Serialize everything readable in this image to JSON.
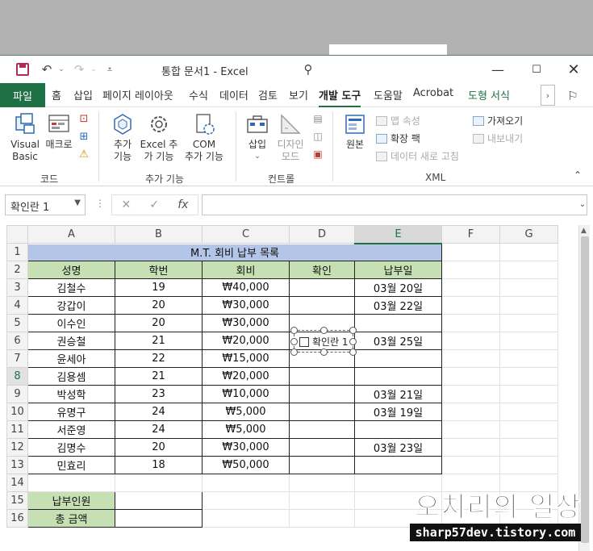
{
  "titlebar": {
    "doc_title": "통합 문서1  -  Excel",
    "undo_icon": "undo-icon",
    "redo_icon": "redo-icon",
    "search_icon": "search-icon"
  },
  "tabs": [
    "파일",
    "홈",
    "삽입",
    "페이지 레이아웃",
    "수식",
    "데이터",
    "검토",
    "보기",
    "개발 도구",
    "도움말",
    "Acrobat",
    "도형 서식"
  ],
  "active_tab": "개발 도구",
  "ribbon": {
    "code": {
      "label": "코드",
      "visual_basic": "Visual\nBasic",
      "macro": "매크로"
    },
    "addins": {
      "label": "추가 기능",
      "addin": "추가\n기능",
      "excel_addin": "Excel 추\n가 기능",
      "com_addin": "COM\n추가 기능"
    },
    "controls": {
      "label": "컨트롤",
      "insert": "삽입",
      "design_mode": "디자인\n모드"
    },
    "xml": {
      "label": "XML",
      "source": "원본",
      "map_props": "맵 속성",
      "expansion_pack": "확장 팩",
      "refresh_data": "데이터 새로 고침",
      "import": "가져오기",
      "export": "내보내기"
    }
  },
  "formula_bar": {
    "name_box": "확인란 1",
    "fx": "fx"
  },
  "sheet": {
    "columns": [
      "A",
      "B",
      "C",
      "D",
      "E",
      "F",
      "G"
    ],
    "selected_column": "E",
    "selected_row": "8",
    "title": "M.T. 회비 납부 목록",
    "headers": [
      "성명",
      "학번",
      "회비",
      "확인",
      "납부일"
    ],
    "rows": [
      {
        "n": "3",
        "name": "김철수",
        "id": "19",
        "fee": "₩40,000",
        "date": "03월 20일"
      },
      {
        "n": "4",
        "name": "강갑이",
        "id": "20",
        "fee": "₩30,000",
        "date": "03월 22일"
      },
      {
        "n": "5",
        "name": "이수인",
        "id": "20",
        "fee": "₩30,000",
        "date": ""
      },
      {
        "n": "6",
        "name": "권승철",
        "id": "21",
        "fee": "₩20,000",
        "date": "03월 25일"
      },
      {
        "n": "7",
        "name": "윤세아",
        "id": "22",
        "fee": "₩15,000",
        "date": ""
      },
      {
        "n": "8",
        "name": "김용셈",
        "id": "21",
        "fee": "₩20,000",
        "date": ""
      },
      {
        "n": "9",
        "name": "박성학",
        "id": "23",
        "fee": "₩10,000",
        "date": "03월 21일"
      },
      {
        "n": "10",
        "name": "유명구",
        "id": "24",
        "fee": "₩5,000",
        "date": "03월 19일"
      },
      {
        "n": "11",
        "name": "서준영",
        "id": "24",
        "fee": "₩5,000",
        "date": ""
      },
      {
        "n": "12",
        "name": "김명수",
        "id": "20",
        "fee": "₩30,000",
        "date": "03월 23일"
      },
      {
        "n": "13",
        "name": "민효리",
        "id": "18",
        "fee": "₩50,000",
        "date": ""
      }
    ],
    "summary": {
      "paid_count_label": "납부인원",
      "total_label": "총 금액"
    },
    "checkbox_label": "확인란 1"
  },
  "watermark": {
    "main": "오치리의 일상",
    "url": "sharp57dev.tistory.com"
  },
  "colors": {
    "excel_green": "#1e7145",
    "title_fill": "#b4c6e7",
    "header_fill": "#c6e0b4"
  }
}
